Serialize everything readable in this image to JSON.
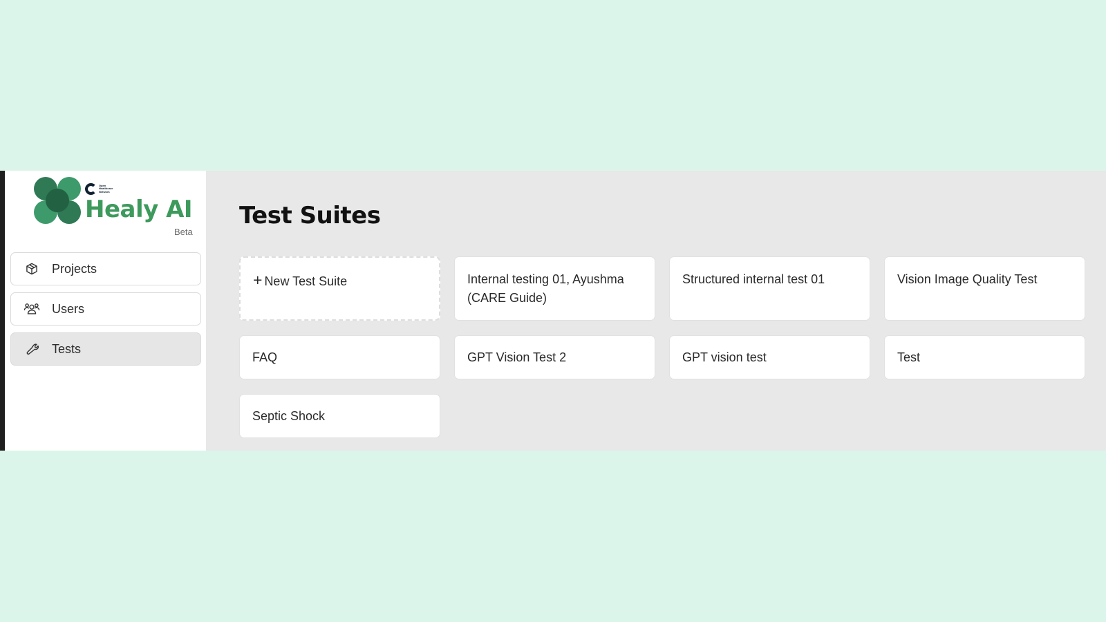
{
  "brand": {
    "org_logo_text": "Open Healthcare Network",
    "name": "Healy AI",
    "badge": "Beta",
    "mark_colors": [
      "#2f7a55",
      "#3d9a6b",
      "#226142"
    ]
  },
  "sidebar": {
    "items": [
      {
        "label": "Projects",
        "icon": "cube-icon",
        "active": false
      },
      {
        "label": "Users",
        "icon": "users-icon",
        "active": false
      },
      {
        "label": "Tests",
        "icon": "wrench-icon",
        "active": true
      }
    ]
  },
  "main": {
    "title": "Test Suites",
    "new_suite_label": "New Test Suite",
    "new_suite_icon": "plus-icon",
    "suites": [
      {
        "name": "Internal testing 01, Ayushma (CARE Guide)"
      },
      {
        "name": "Structured internal test 01"
      },
      {
        "name": "Vision Image Quality Test"
      },
      {
        "name": "FAQ"
      },
      {
        "name": "GPT Vision Test 2"
      },
      {
        "name": "GPT vision test"
      },
      {
        "name": "Test"
      },
      {
        "name": "Septic Shock"
      }
    ]
  },
  "colors": {
    "page_background": "#dcf5ea",
    "brand_green": "#3d9a5c",
    "main_background": "#e8e8e8"
  }
}
